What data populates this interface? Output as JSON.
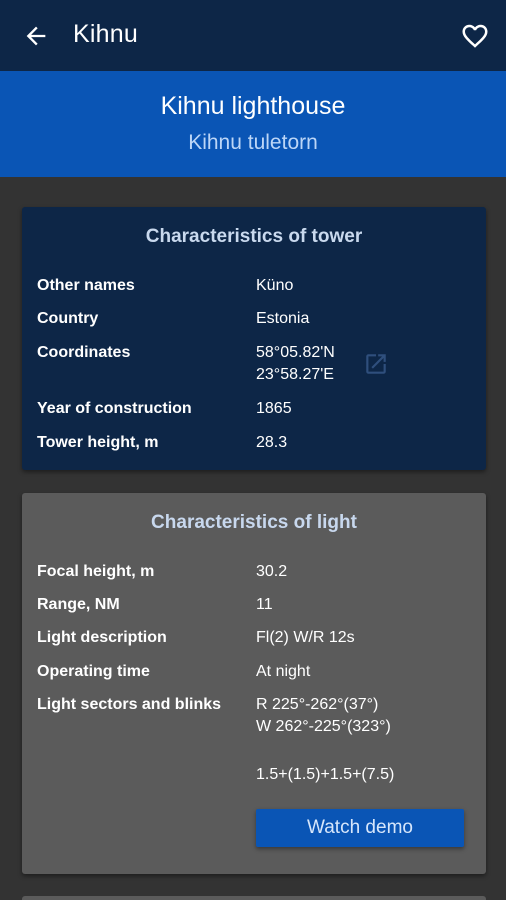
{
  "appbar": {
    "title": "Kihnu"
  },
  "hero": {
    "title": "Kihnu lighthouse",
    "subtitle": "Kihnu tuletorn"
  },
  "tower": {
    "title": "Characteristics of tower",
    "rows": [
      {
        "label": "Other names",
        "value": "Küno"
      },
      {
        "label": "Country",
        "value": "Estonia"
      },
      {
        "label": "Coordinates",
        "value_lines": [
          "58°05.82'N",
          "23°58.27'E"
        ]
      },
      {
        "label": "Year of construction",
        "value": "1865"
      },
      {
        "label": "Tower height, m",
        "value": "28.3"
      }
    ]
  },
  "light": {
    "title": "Characteristics of light",
    "rows": [
      {
        "label": "Focal height, m",
        "value": "30.2"
      },
      {
        "label": "Range, NM",
        "value": "11"
      },
      {
        "label": "Light description",
        "value": "Fl(2) W/R 12s"
      },
      {
        "label": "Operating time",
        "value": "At night"
      },
      {
        "label": "Light sectors and blinks",
        "value_lines": [
          "R 225°-262°(37°)",
          "W 262°-225°(323°)"
        ]
      }
    ],
    "blinks": "1.5+(1.5)+1.5+(7.5)",
    "watch_label": "Watch demo"
  },
  "icons": {
    "back": "arrow-left-icon",
    "favorite": "heart-outline-icon",
    "open_map": "open-in-new-icon"
  },
  "colors": {
    "appbar": "#0d2647",
    "hero": "#0a55b5",
    "tower_card": "#0d2647",
    "light_card": "#5b5b5b",
    "background": "#333333",
    "button": "#0a55b5"
  }
}
